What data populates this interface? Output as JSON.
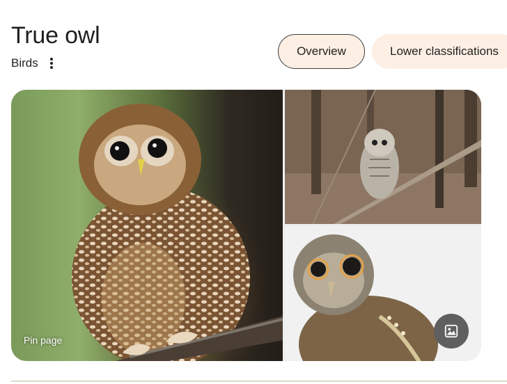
{
  "header": {
    "title": "True owl",
    "subtitle": "Birds"
  },
  "chips": [
    {
      "label": "Overview",
      "selected": true
    },
    {
      "label": "Lower classifications",
      "selected": false
    }
  ],
  "gallery": {
    "images": [
      {
        "subject": "spotted owl perched on branch"
      },
      {
        "subject": "barred owl in forest"
      },
      {
        "subject": "screech owl illustration"
      }
    ],
    "overlay_label": "Pin page",
    "image_button_icon": "image-icon"
  },
  "colors": {
    "chip_background": "#fdefe4",
    "image_button": "#5f5f5f"
  }
}
